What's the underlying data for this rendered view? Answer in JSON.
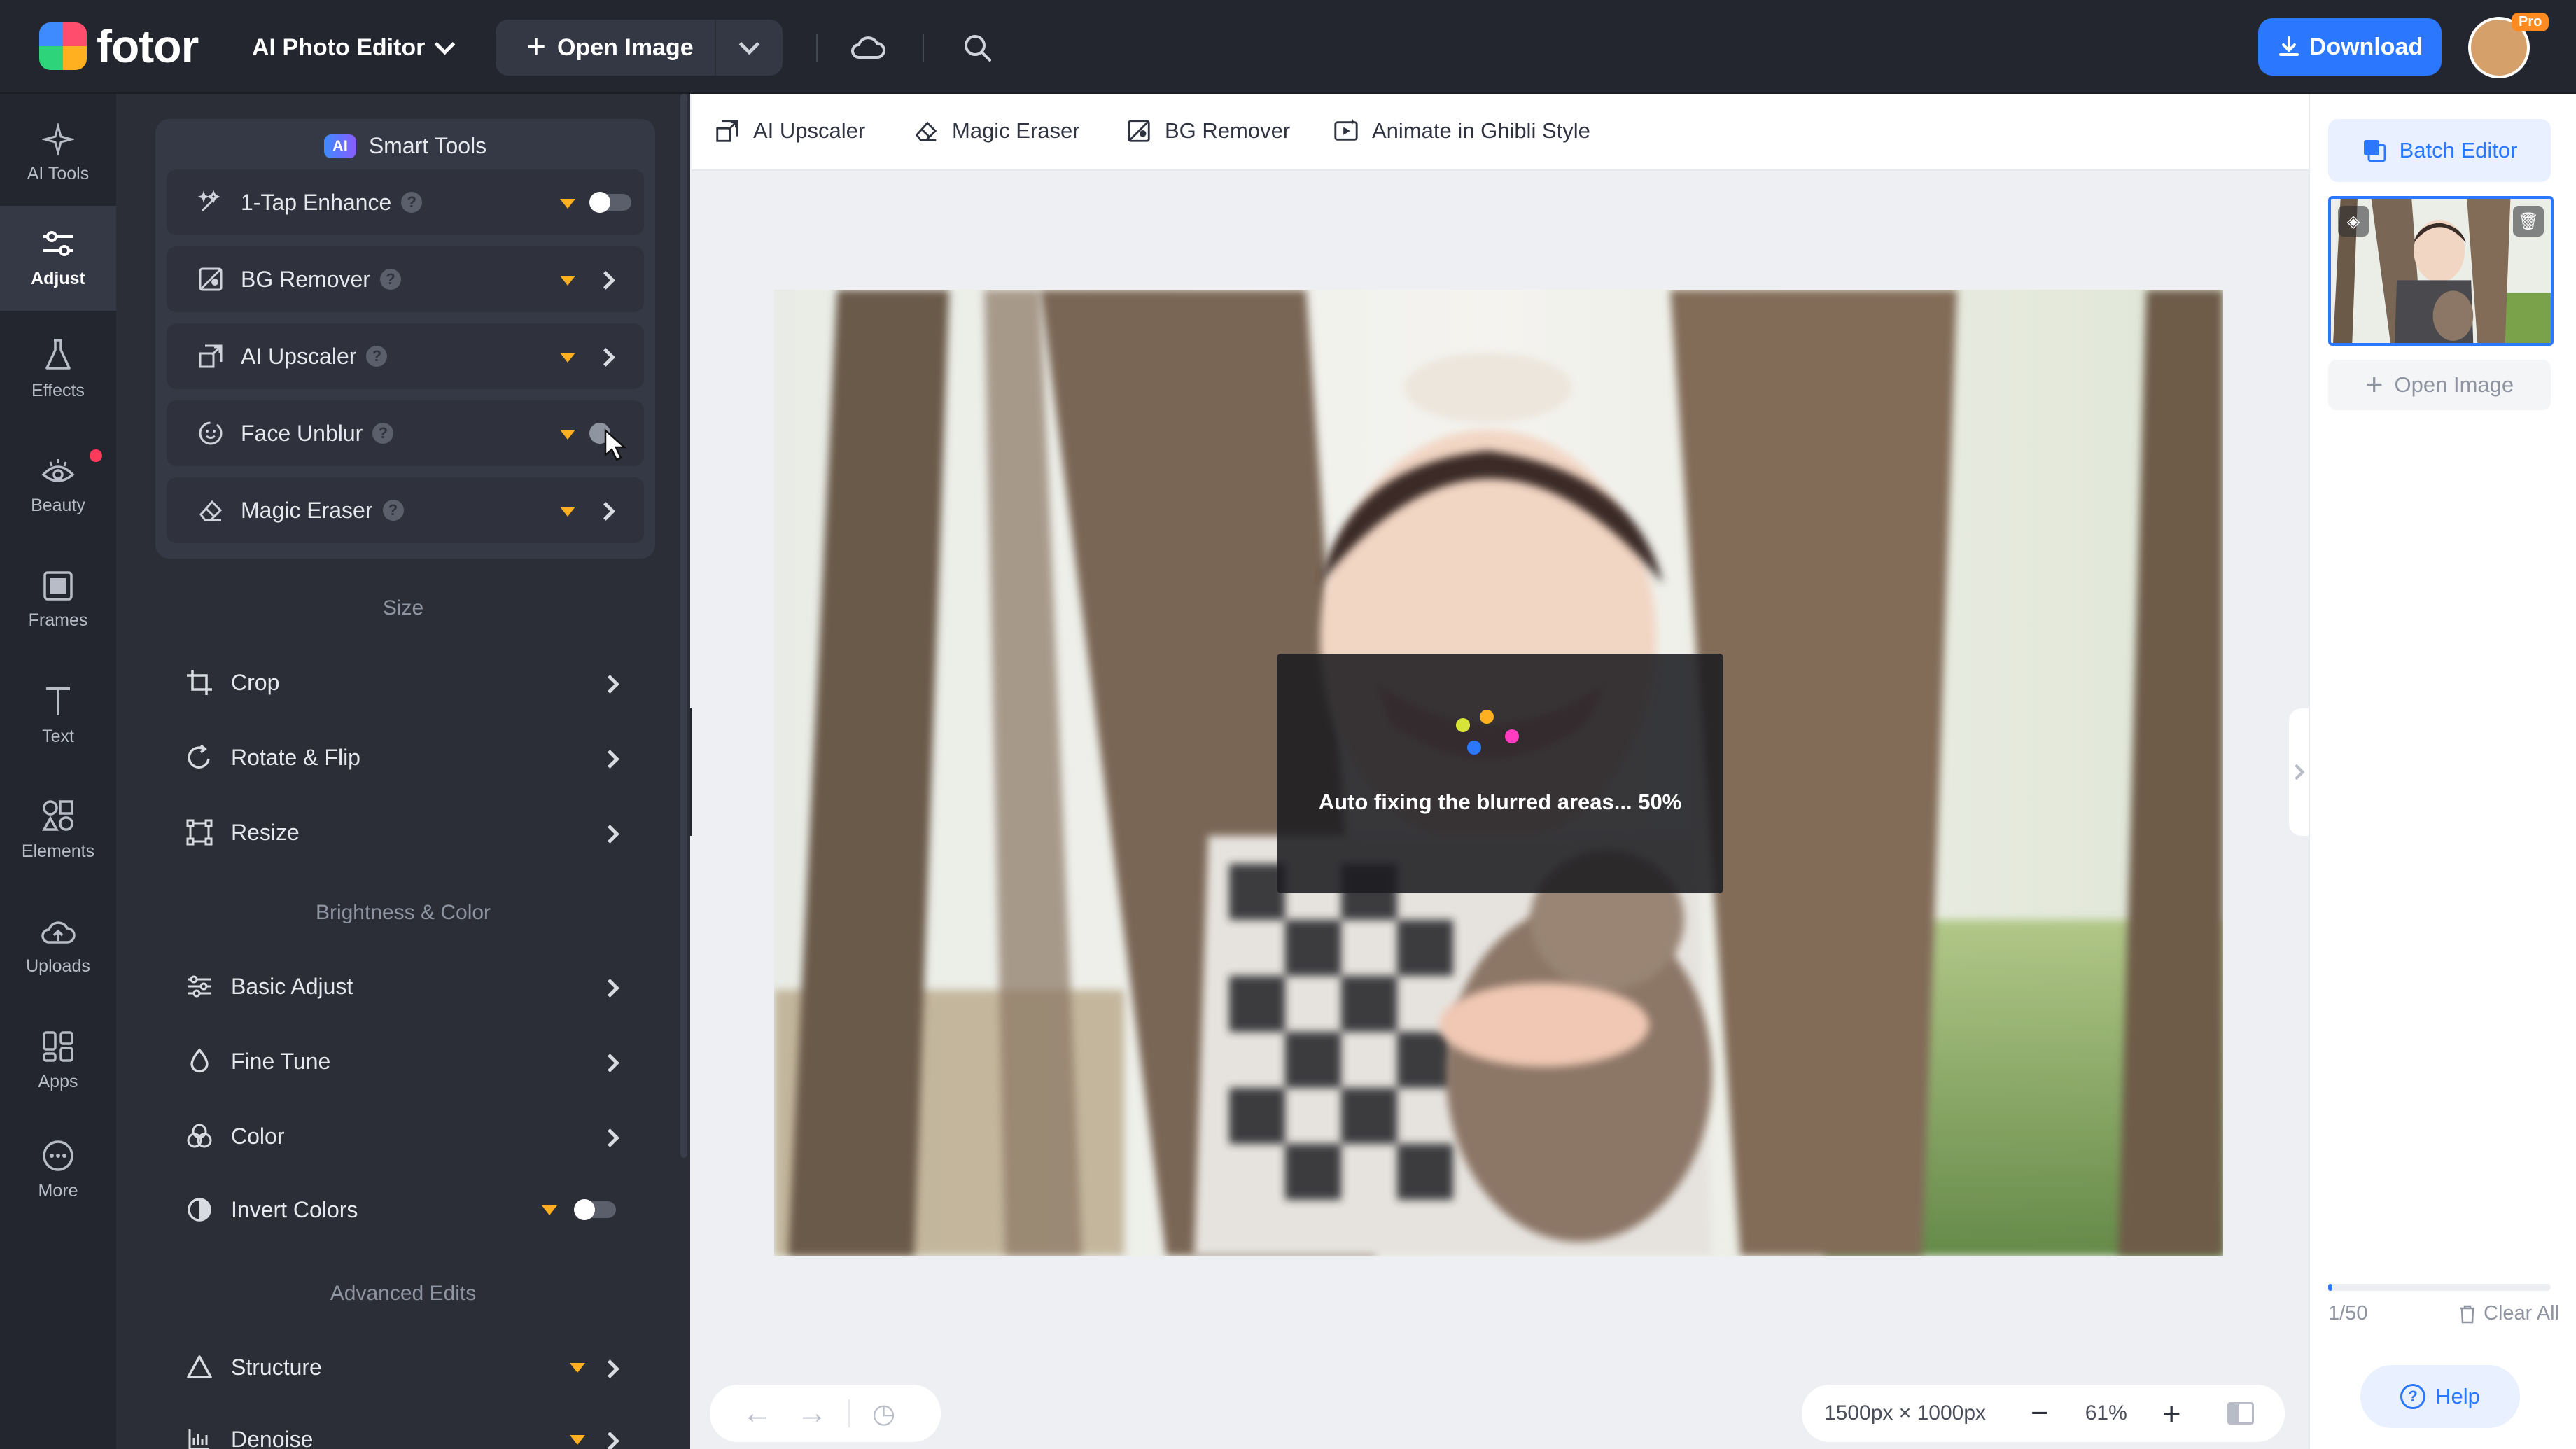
{
  "header": {
    "brand": "fotor",
    "app_menu_label": "AI Photo Editor",
    "open_image_label": "Open Image",
    "download_label": "Download",
    "pro_badge": "Pro",
    "icons": [
      "cloud-icon",
      "search-icon"
    ]
  },
  "rail": {
    "items": [
      {
        "label": "AI Tools",
        "icon": "sparkle-icon"
      },
      {
        "label": "Adjust",
        "icon": "sliders-icon",
        "active": true
      },
      {
        "label": "Effects",
        "icon": "flask-icon"
      },
      {
        "label": "Beauty",
        "icon": "eye-icon",
        "notification": true
      },
      {
        "label": "Frames",
        "icon": "frame-icon"
      },
      {
        "label": "Text",
        "icon": "text-icon"
      },
      {
        "label": "Elements",
        "icon": "shapes-icon"
      },
      {
        "label": "Uploads",
        "icon": "cloud-upload-icon"
      },
      {
        "label": "Apps",
        "icon": "apps-icon"
      },
      {
        "label": "More",
        "icon": "more-icon"
      }
    ]
  },
  "smart_tools": {
    "badge": "AI",
    "title": "Smart Tools",
    "items": [
      {
        "label": "1-Tap Enhance",
        "control": "toggle",
        "premium": true
      },
      {
        "label": "BG Remover",
        "control": "arrow",
        "premium": true
      },
      {
        "label": "AI Upscaler",
        "control": "arrow",
        "premium": true
      },
      {
        "label": "Face Unblur",
        "control": "toggle",
        "premium": true
      },
      {
        "label": "Magic Eraser",
        "control": "arrow",
        "premium": true
      }
    ]
  },
  "sections": {
    "size": {
      "title": "Size",
      "items": [
        "Crop",
        "Rotate & Flip",
        "Resize"
      ]
    },
    "brightness": {
      "title": "Brightness & Color",
      "items": [
        "Basic Adjust",
        "Fine Tune",
        "Color",
        "Invert Colors"
      ]
    },
    "advanced": {
      "title": "Advanced Edits",
      "items": [
        "Structure",
        "Denoise"
      ]
    }
  },
  "quickbar": {
    "items": [
      "AI Upscaler",
      "Magic Eraser",
      "BG Remover",
      "Animate in Ghibli Style"
    ]
  },
  "overlay": {
    "message": "Auto fixing the blurred areas... 50%",
    "progress": 0.5
  },
  "canvas_footer": {
    "dimensions": "1500px × 1000px",
    "zoom": "61%"
  },
  "right_panel": {
    "batch_editor_label": "Batch Editor",
    "open_image_label": "Open Image",
    "count": "1/50",
    "count_progress": 0.02,
    "clear_all_label": "Clear All",
    "help_label": "Help"
  },
  "colors": {
    "accent": "#2b78ff",
    "dark_bg": "#23262f",
    "panel_bg": "#2b2e37",
    "premium": "#ffb020"
  }
}
